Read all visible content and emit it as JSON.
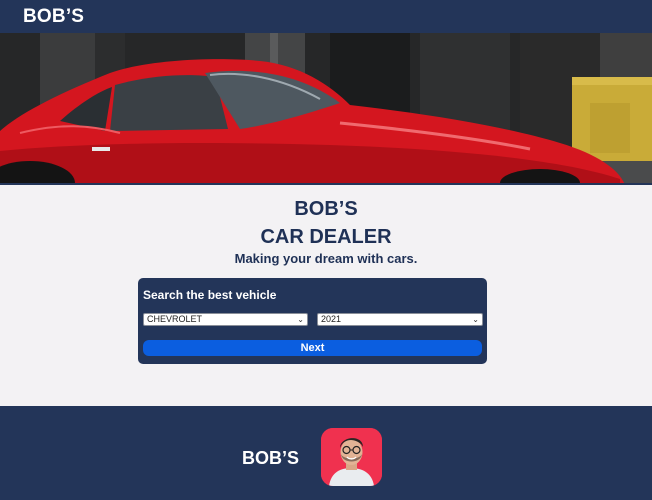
{
  "header": {
    "brand": "BOB’S"
  },
  "hero": {
    "image": "red-sports-car-photo"
  },
  "main": {
    "title_line1": "BOB’S",
    "title_line2": "CAR DEALER",
    "tagline": "Making your dream with cars."
  },
  "search": {
    "heading": "Search the best vehicle",
    "make_value": "CHEVROLET",
    "year_value": "2021",
    "next_label": "Next"
  },
  "footer": {
    "brand": "BOB’S",
    "avatar": "person-avatar"
  },
  "colors": {
    "navy": "#233559",
    "accent_blue": "#0b5ee0",
    "avatar_bg": "#f0314f",
    "page_bg": "#f3f2f4"
  },
  "icons": {
    "select_chevron": "chevron-down-icon"
  }
}
